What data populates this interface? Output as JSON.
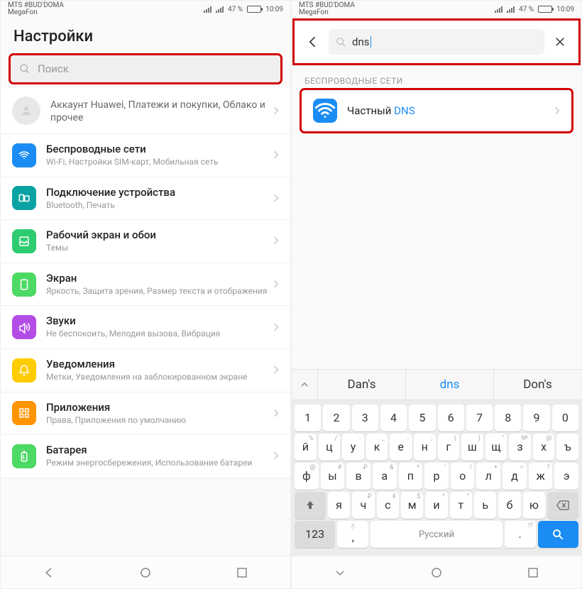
{
  "status": {
    "carrier_top": "MTS #BUD'DOMA",
    "carrier_sub": "MegaFon",
    "battery_pct": "47 %",
    "time": "10:09"
  },
  "left": {
    "title": "Настройки",
    "search_placeholder": "Поиск",
    "account": {
      "title": "Аккаунт Huawei, Платежи и покупки, Облако и прочее"
    },
    "items": [
      {
        "title": "Беспроводные сети",
        "sub": "Wi-Fi, Настройки SIM-карт, Мобильная сеть"
      },
      {
        "title": "Подключение устройства",
        "sub": "Bluetooth, Печать"
      },
      {
        "title": "Рабочий экран и обои",
        "sub": "Темы"
      },
      {
        "title": "Экран",
        "sub": "Яркость, Защита зрения, Размер текста и отображения"
      },
      {
        "title": "Звуки",
        "sub": "Не беспокоить, Мелодия вызова, Вибрация"
      },
      {
        "title": "Уведомления",
        "sub": "Метки, Уведомления на заблокированном экране"
      },
      {
        "title": "Приложения",
        "sub": "Права, Приложения по умолчанию"
      },
      {
        "title": "Батарея",
        "sub": "Режим энергосбережения, Использование батареи"
      }
    ]
  },
  "right": {
    "query": "dns",
    "section_header": "БЕСПРОВОДНЫЕ СЕТИ",
    "result_prefix": "Частный ",
    "result_highlight": "DNS",
    "suggestions": [
      "Dan's",
      "dns",
      "Don's"
    ],
    "keyboard": {
      "row_digits": [
        "1",
        "2",
        "3",
        "4",
        "5",
        "6",
        "7",
        "8",
        "9",
        "0"
      ],
      "row2_main": [
        "й",
        "ц",
        "у",
        "к",
        "е",
        "н",
        "г",
        "ш",
        "щ",
        "з",
        "х",
        "ъ"
      ],
      "row2_alt": [
        "%",
        "/",
        "-",
        "_",
        ":",
        ";",
        "(",
        ")",
        "\"",
        "№",
        "@",
        ""
      ],
      "row3_main": [
        "ф",
        "ы",
        "в",
        "а",
        "п",
        "р",
        "о",
        "л",
        "д",
        "ж",
        "э"
      ],
      "row3_alt": [
        "@",
        "#",
        "₽",
        "&",
        "*",
        "'",
        "!",
        "+",
        "=",
        "?",
        ""
      ],
      "row4_main": [
        "я",
        "ч",
        "с",
        "м",
        "и",
        "т",
        "ь",
        "б",
        "ю"
      ],
      "row4_alt": [
        "",
        "₽",
        "€",
        "$",
        "^",
        "°",
        "",
        "",
        ""
      ],
      "mode_key": "123",
      "comma": ",",
      "period": ".",
      "space_label": "Русский",
      "period_alt": "!?"
    }
  }
}
